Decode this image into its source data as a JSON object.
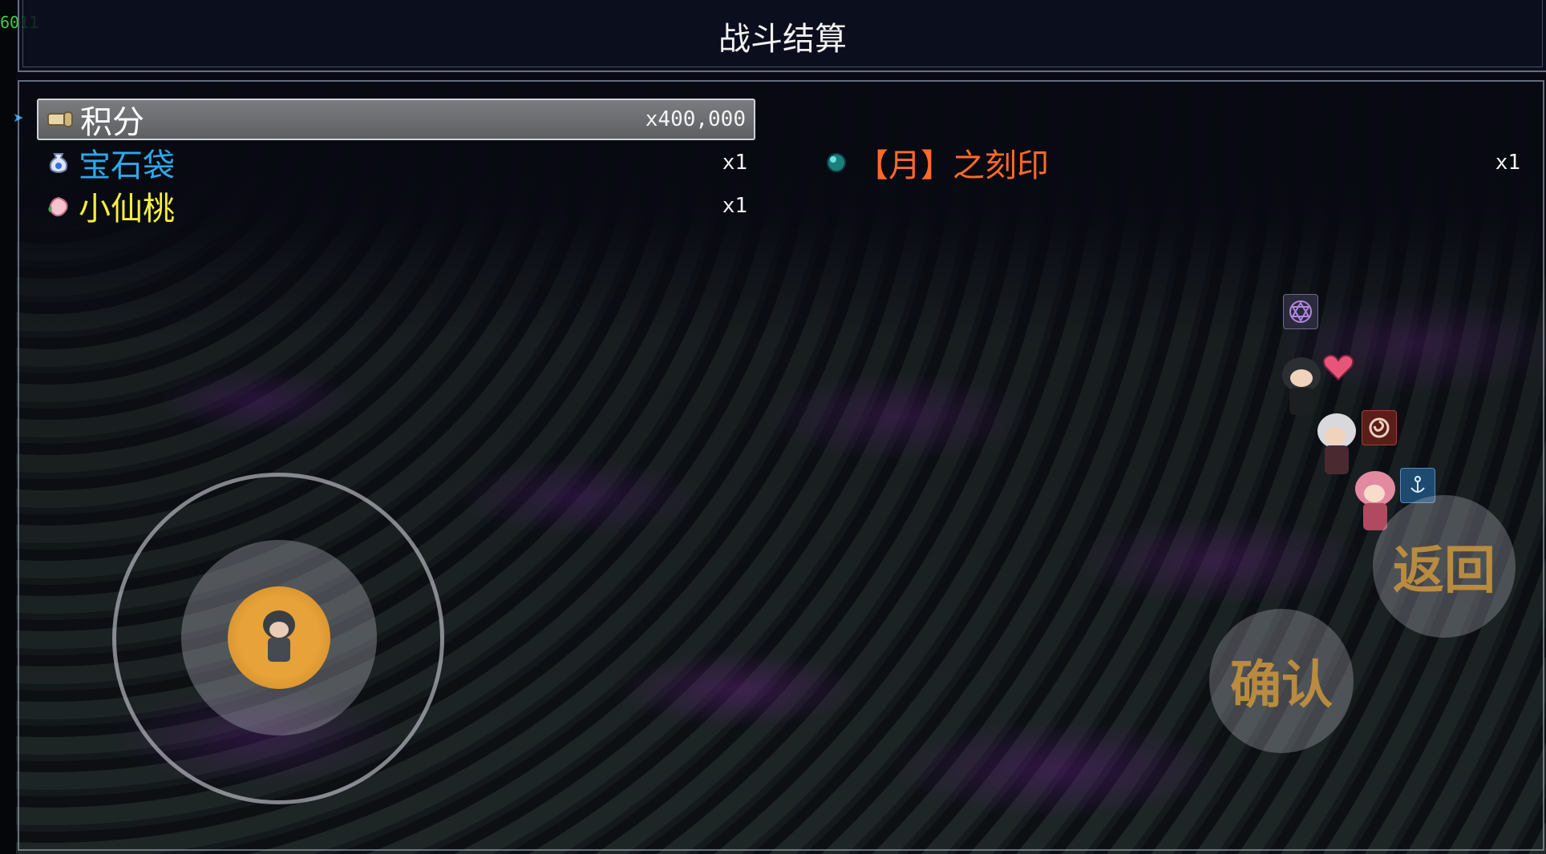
{
  "debug": {
    "fps": "6011"
  },
  "header": {
    "title": "战斗结算"
  },
  "rewards": [
    {
      "name": "积分",
      "qty": "x400,000",
      "color": "#ffffff",
      "icon": "scroll-icon",
      "selected": true
    },
    {
      "name": "宝石袋",
      "qty": "x1",
      "color": "#2ea8e8",
      "icon": "gem-bag-icon",
      "selected": false
    },
    {
      "name": "【月】之刻印",
      "qty": "x1",
      "color": "#ff6a2a",
      "icon": "moon-orb-icon",
      "selected": false
    },
    {
      "name": "小仙桃",
      "qty": "x1",
      "color": "#f4ee3c",
      "icon": "peach-icon",
      "selected": false
    }
  ],
  "controls": {
    "back_label": "返回",
    "confirm_label": "确认"
  },
  "party_status_icons": [
    "hexagram-icon",
    "heart-icon",
    "swirl-icon",
    "anchor-icon"
  ]
}
